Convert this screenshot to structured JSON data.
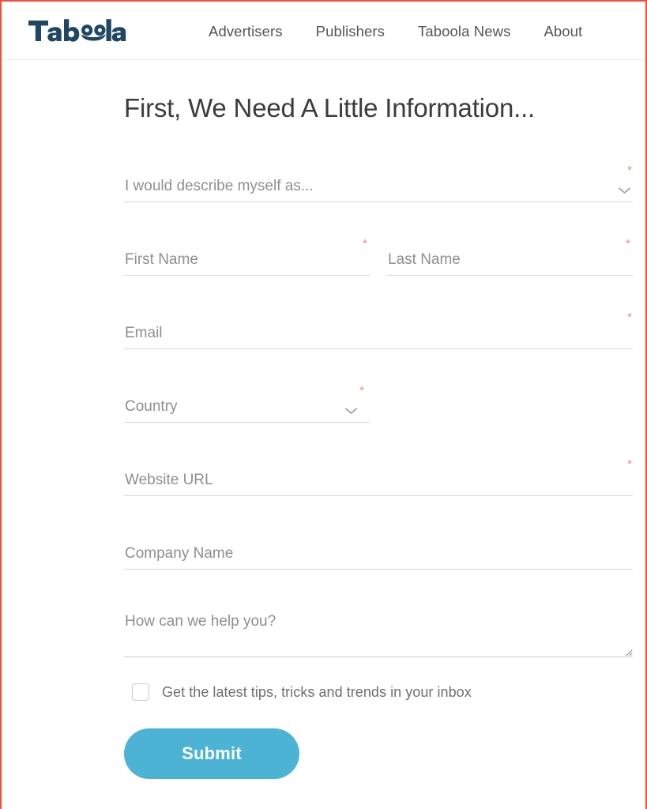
{
  "header": {
    "logo_text": "Taboola",
    "logo_color": "#1f4763",
    "nav": [
      {
        "label": "Advertisers",
        "name": "nav-link-advertisers"
      },
      {
        "label": "Publishers",
        "name": "nav-link-publishers"
      },
      {
        "label": "Taboola News",
        "name": "nav-link-taboola-news"
      },
      {
        "label": "About",
        "name": "nav-link-about"
      }
    ]
  },
  "main": {
    "title": "First, We Need A Little Information...",
    "form": {
      "describe_myself": {
        "placeholder": "I would describe myself as...",
        "value": "",
        "required_marker": "*"
      },
      "first_name": {
        "placeholder": "First Name",
        "value": "",
        "required_marker": "*"
      },
      "last_name": {
        "placeholder": "Last Name",
        "value": "",
        "required_marker": "*"
      },
      "email": {
        "placeholder": "Email",
        "value": "",
        "required_marker": "*"
      },
      "country": {
        "placeholder": "Country",
        "value": "",
        "required_marker": "*"
      },
      "website_url": {
        "placeholder": "Website URL",
        "value": "",
        "required_marker": "*"
      },
      "company_name": {
        "placeholder": "Company Name",
        "value": ""
      },
      "message": {
        "placeholder": "How can we help you?",
        "value": ""
      },
      "optin_label": "Get the latest tips, tricks and trends in your inbox",
      "optin_checked": false,
      "submit_label": "Submit"
    }
  },
  "colors": {
    "brand_navy": "#1f4763",
    "submit_blue": "#4cb3d4",
    "required_star": "#ec8b82",
    "page_border_red": "#f0503a",
    "placeholder_gray": "#8f8f8f"
  },
  "icons": {
    "chevron_down": "chevron-down-icon",
    "resize_grip": "resize-grip-icon"
  }
}
